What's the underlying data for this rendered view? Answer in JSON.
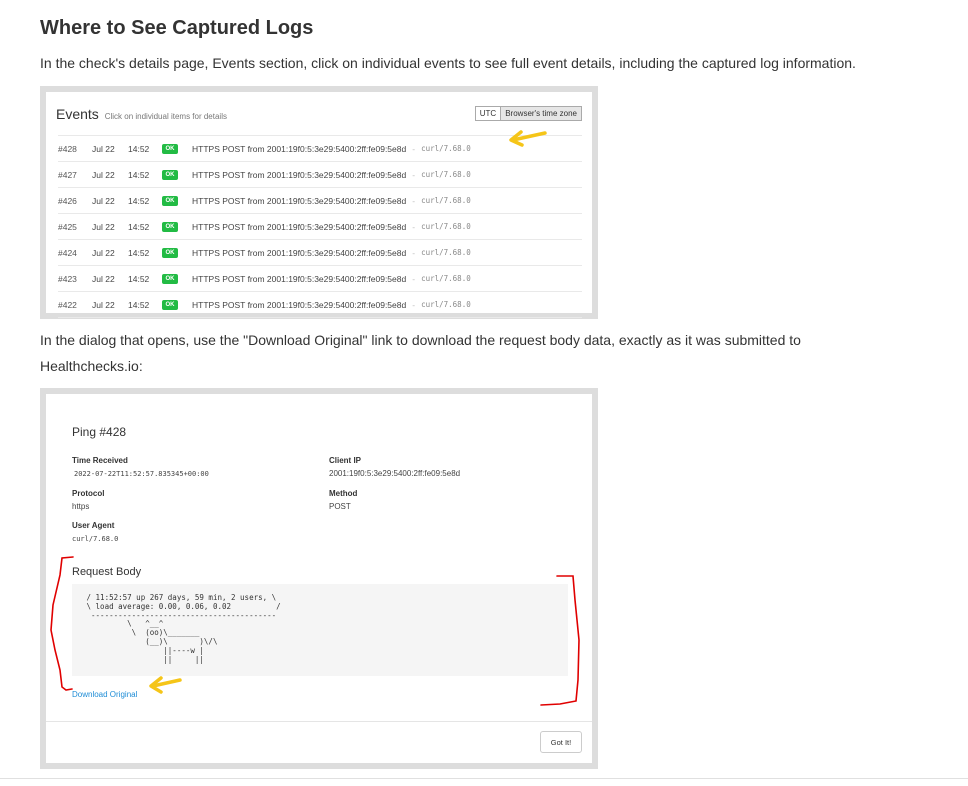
{
  "article": {
    "heading": "Where to See Captured Logs",
    "para1": "In the check's details page, Events section, click on individual events to see full event details, including the captured log information.",
    "para2": "In the dialog that opens, use the \"Download Original\" link to download the request body data, exactly as it was submitted to Healthchecks.io:"
  },
  "events": {
    "title": "Events",
    "subtitle": "Click on individual items for details",
    "tz_utc": "UTC",
    "tz_browser": "Browser's time zone",
    "rows": [
      {
        "num": "#428",
        "date": "Jul 22",
        "time": "14:52",
        "badge": "OK",
        "desc": "HTTPS POST from 2001:19f0:5:3e29:5400:2ff:fe09:5e8d",
        "dash": "-",
        "ua": "curl/7.68.0"
      },
      {
        "num": "#427",
        "date": "Jul 22",
        "time": "14:52",
        "badge": "OK",
        "desc": "HTTPS POST from 2001:19f0:5:3e29:5400:2ff:fe09:5e8d",
        "dash": "-",
        "ua": "curl/7.68.0"
      },
      {
        "num": "#426",
        "date": "Jul 22",
        "time": "14:52",
        "badge": "OK",
        "desc": "HTTPS POST from 2001:19f0:5:3e29:5400:2ff:fe09:5e8d",
        "dash": "-",
        "ua": "curl/7.68.0"
      },
      {
        "num": "#425",
        "date": "Jul 22",
        "time": "14:52",
        "badge": "OK",
        "desc": "HTTPS POST from 2001:19f0:5:3e29:5400:2ff:fe09:5e8d",
        "dash": "-",
        "ua": "curl/7.68.0"
      },
      {
        "num": "#424",
        "date": "Jul 22",
        "time": "14:52",
        "badge": "OK",
        "desc": "HTTPS POST from 2001:19f0:5:3e29:5400:2ff:fe09:5e8d",
        "dash": "-",
        "ua": "curl/7.68.0"
      },
      {
        "num": "#423",
        "date": "Jul 22",
        "time": "14:52",
        "badge": "OK",
        "desc": "HTTPS POST from 2001:19f0:5:3e29:5400:2ff:fe09:5e8d",
        "dash": "-",
        "ua": "curl/7.68.0"
      },
      {
        "num": "#422",
        "date": "Jul 22",
        "time": "14:52",
        "badge": "OK",
        "desc": "HTTPS POST from 2001:19f0:5:3e29:5400:2ff:fe09:5e8d",
        "dash": "-",
        "ua": "curl/7.68.0"
      }
    ]
  },
  "dialog": {
    "title": "Ping #428",
    "time_received_label": "Time Received",
    "time_received": "2022-07-22T11:52:57.835345+00:00",
    "client_ip_label": "Client IP",
    "client_ip": "2001:19f0:5:3e29:5400:2ff:fe09:5e8d",
    "protocol_label": "Protocol",
    "protocol": "https",
    "method_label": "Method",
    "method": "POST",
    "user_agent_label": "User Agent",
    "user_agent": "curl/7.68.0",
    "request_body_label": "Request Body",
    "request_body": " / 11:52:57 up 267 days, 59 min, 2 users, \\\n \\ load average: 0.00, 0.06, 0.02          /\n  -----------------------------------------\n          \\   ^__^\n           \\  (oo)\\_______\n              (__)\\       )\\/\\\n                  ||----w |\n                  ||     ||",
    "download_label": "Download Original",
    "got_it_label": "Got It!"
  },
  "annotation_colors": {
    "arrow": "#f5c518",
    "bracket": "#e00000",
    "badge": "#22bb44",
    "link": "#1f8dd6"
  }
}
